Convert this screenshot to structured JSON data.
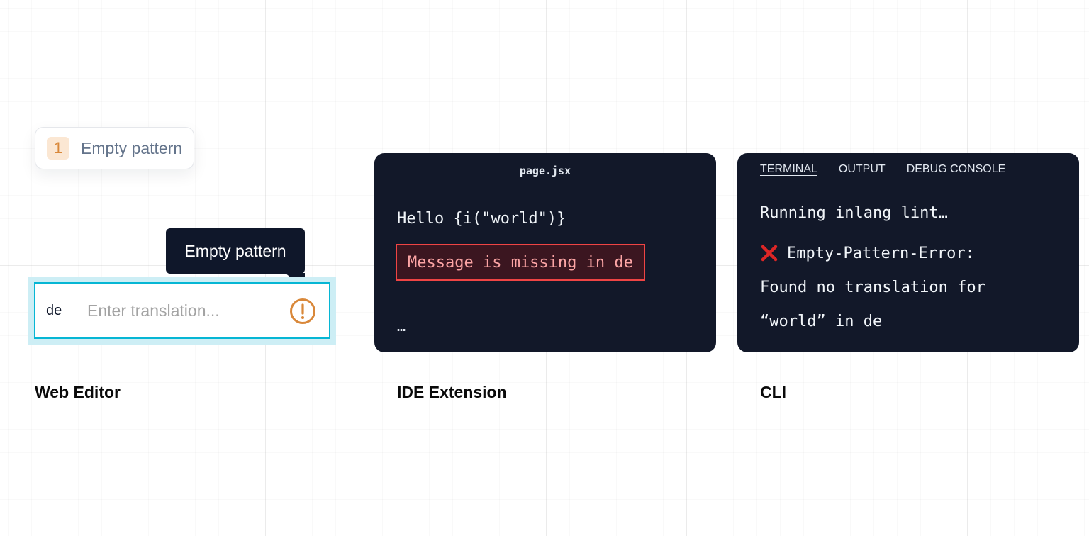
{
  "web_editor": {
    "lint_chip": {
      "count": "1",
      "label": "Empty pattern"
    },
    "tooltip": "Empty pattern",
    "language": "de",
    "input_placeholder": "Enter translation...",
    "caption": "Web Editor",
    "icon": "warning-circle-icon",
    "colors": {
      "accent": "#06b6d4",
      "warning": "#d9883a",
      "warning_bg": "#fbe7d3"
    }
  },
  "ide_extension": {
    "filename": "page.jsx",
    "code_line": "Hello {i(\"world\")}",
    "error_message": "Message is missing in de",
    "ellipsis": "…",
    "caption": "IDE Extension",
    "colors": {
      "panel_bg": "#121829",
      "error_border": "#ef4444",
      "error_text": "#fca5a5"
    }
  },
  "cli": {
    "tabs": [
      {
        "label": "TERMINAL",
        "active": true
      },
      {
        "label": "OUTPUT",
        "active": false
      },
      {
        "label": "DEBUG CONSOLE",
        "active": false
      }
    ],
    "lines": {
      "running": "Running inlang lint…",
      "error_title": "Empty-Pattern-Error:",
      "error_detail_1": "Found no translation for",
      "error_detail_2": "“world” in de"
    },
    "error_icon": "x-mark-icon",
    "caption": "CLI",
    "colors": {
      "error_icon": "#dc2626"
    }
  }
}
